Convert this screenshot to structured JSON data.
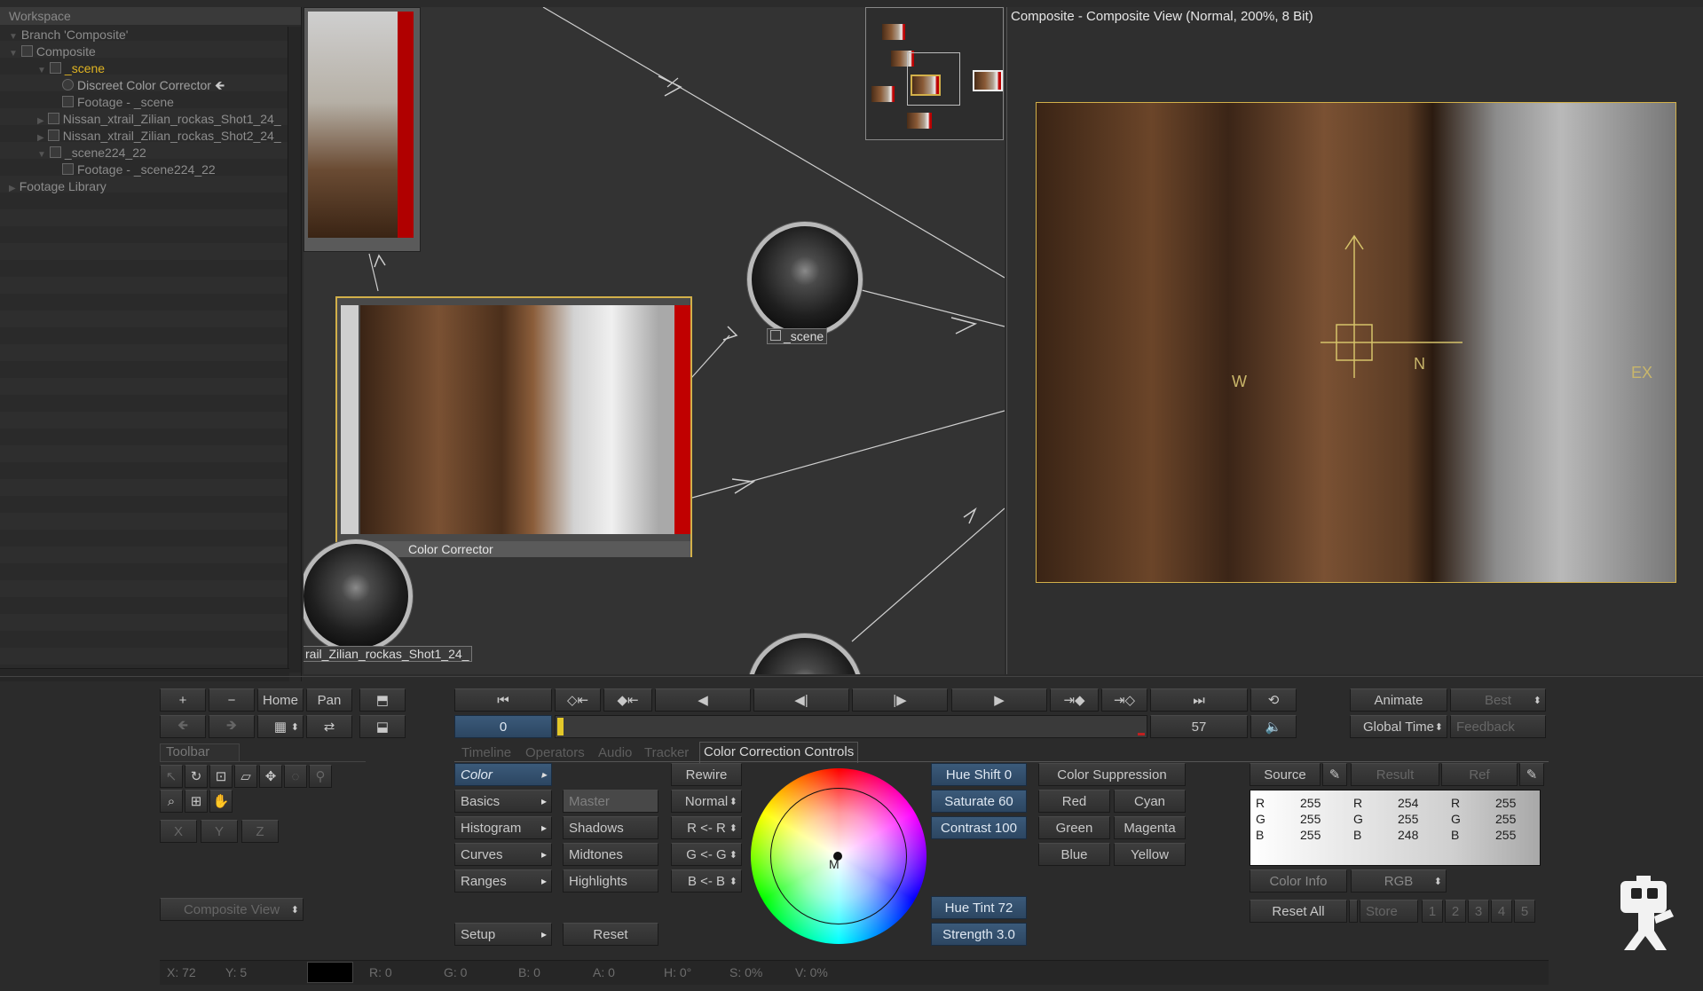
{
  "workspace": {
    "header": "Workspace",
    "tree": [
      {
        "label": "Branch 'Composite'",
        "selected": false
      },
      {
        "label": "Composite",
        "selected": false
      },
      {
        "label": "_scene",
        "selected": true
      },
      {
        "label": "Discreet Color Corrector",
        "selected": false
      },
      {
        "label": "Footage - _scene",
        "selected": false
      },
      {
        "label": "Nissan_xtrail_Zilian_rockas_Shot1_24_",
        "selected": false
      },
      {
        "label": "Nissan_xtrail_Zilian_rockas_Shot2_24_",
        "selected": false
      },
      {
        "label": "_scene224_22",
        "selected": false
      },
      {
        "label": "Footage - _scene224_22",
        "selected": false
      },
      {
        "label": "Footage Library",
        "selected": false
      }
    ]
  },
  "schematic": {
    "color_corrector_label": "Color Corrector",
    "scene_label": "_scene",
    "shot_label": "rail_Zilian_rockas_Shot1_24_"
  },
  "composite_view": {
    "title": "Composite - Composite View (Normal, 200%, 8 Bit)",
    "gizmo_labels": [
      "N",
      "W",
      "EX"
    ]
  },
  "view_controls": {
    "plus": "+",
    "minus": "−",
    "home": "Home",
    "pan": "Pan"
  },
  "transport": {
    "current_frame": "0",
    "end_frame": "57",
    "animate": "Animate",
    "best": "Best",
    "global_time": "Global Time",
    "feedback": "Feedback"
  },
  "toolbar": {
    "title": "Toolbar",
    "x": "X",
    "y": "Y",
    "z": "Z",
    "view_select": "Composite View"
  },
  "tabs": [
    {
      "label": "Timeline",
      "active": false
    },
    {
      "label": "Operators",
      "active": false
    },
    {
      "label": "Audio",
      "active": false
    },
    {
      "label": "Tracker",
      "active": false
    },
    {
      "label": "Color Correction Controls",
      "active": true
    }
  ],
  "color_controls": {
    "menu": [
      "Color",
      "Basics",
      "Histogram",
      "Curves",
      "Ranges"
    ],
    "setup": "Setup",
    "rewire": "Rewire",
    "ranges": [
      "Master",
      "Shadows",
      "Midtones",
      "Highlights"
    ],
    "rewire_opts": [
      "Normal",
      "R <- R",
      "G <- G",
      "B <- B"
    ],
    "reset": "Reset",
    "wheel_marker": "M",
    "hue_shift": "Hue Shift 0",
    "saturate": "Saturate 60",
    "contrast": "Contrast 100",
    "hue_tint": "Hue Tint 72",
    "strength": "Strength 3.0",
    "suppression_title": "Color Suppression",
    "suppression": [
      "Red",
      "Cyan",
      "Green",
      "Magenta",
      "Blue",
      "Yellow"
    ]
  },
  "color_info": {
    "source": "Source",
    "result": "Result",
    "ref": "Ref",
    "source_vals": {
      "R": "255",
      "G": "255",
      "B": "255"
    },
    "result_vals": {
      "R": "254",
      "G": "255",
      "B": "248"
    },
    "ref_vals": {
      "R": "255",
      "G": "255",
      "B": "255"
    },
    "color_info_label": "Color Info",
    "mode": "RGB",
    "reset_all": "Reset All",
    "store": "Store",
    "slots": [
      "1",
      "2",
      "3",
      "4",
      "5"
    ]
  },
  "status": {
    "x": "X:  72",
    "y": "Y:  5",
    "r": "R: 0",
    "g": "G: 0",
    "b": "B: 0",
    "a": "A: 0",
    "h": "H: 0°",
    "s": "S: 0%",
    "v": "V: 0%"
  },
  "colors": {
    "accent_blue": "#3b5a7a",
    "selection_gold": "#d2b04a",
    "highlight_yellow": "#e0b422"
  }
}
